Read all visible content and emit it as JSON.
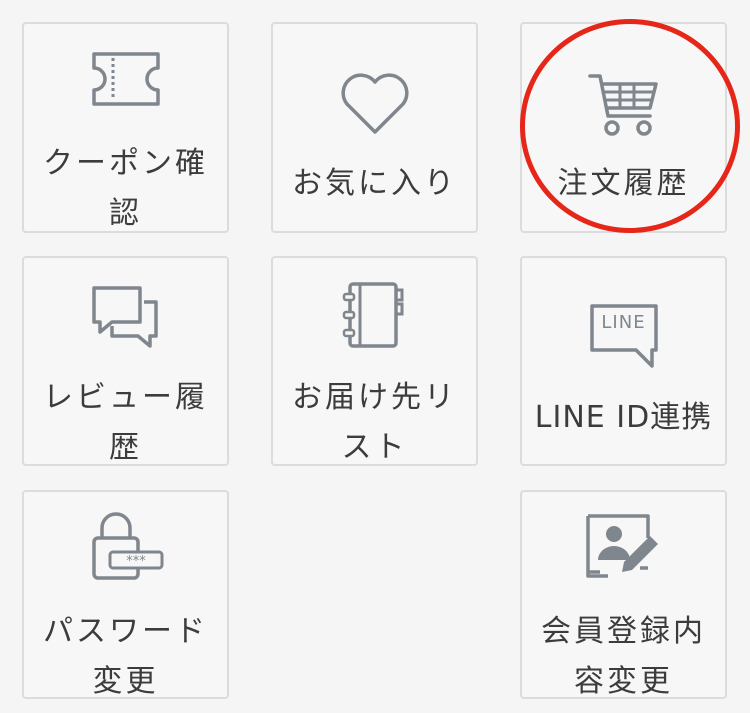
{
  "menu": {
    "coupon": "クーポン確認",
    "favorites": "お気に入り",
    "orders": "注文履歴",
    "reviews": "レビュー履歴",
    "addresses": "お届け先リスト",
    "line": "LINE ID連携",
    "line_icon_text": "LINE",
    "password": "パスワード変更",
    "profile": "会員登録内容変更"
  },
  "colors": {
    "icon": "#7f868d",
    "highlight": "#e62619",
    "tile_border": "#dcdcdc"
  }
}
